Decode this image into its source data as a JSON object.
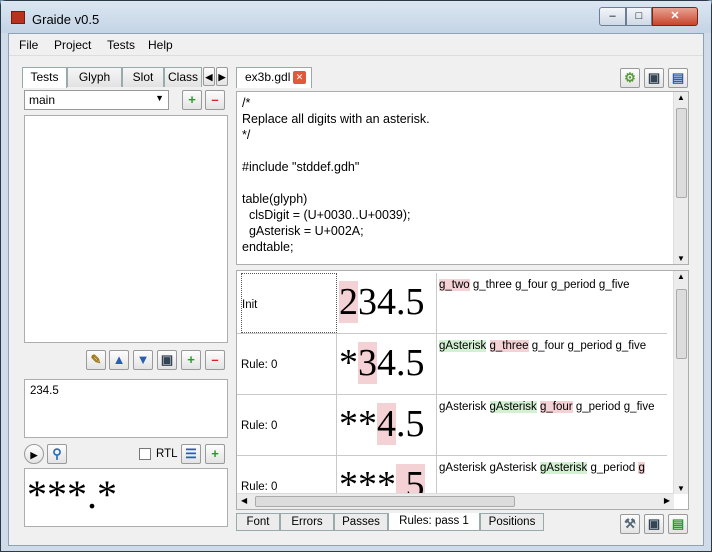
{
  "window": {
    "title": "Graide v0.5"
  },
  "menu": [
    "File",
    "Project",
    "Tests",
    "Help"
  ],
  "left": {
    "tabs": [
      "Tests",
      "Glyph",
      "Slot",
      "Class"
    ],
    "test_group": "main",
    "test_text": "234.5",
    "rtl_label": "RTL",
    "rendered_output": "***.*"
  },
  "editor": {
    "tab": "ex3b.gdl",
    "lines": [
      "/*",
      "Replace all digits with an asterisk.",
      "*/",
      "",
      "#include \"stddef.gdh\"",
      "",
      "table(glyph)",
      "  clsDigit = (U+0030..U+0039);",
      "  gAsterisk = U+002A;",
      "endtable;"
    ]
  },
  "rules": [
    {
      "label": "Init",
      "glyph_prefix": "",
      "glyph_hl": "2",
      "glyph_rest": "34.5",
      "names": [
        {
          "t": "g_two",
          "h": "red"
        },
        {
          "t": "g_three",
          "h": ""
        },
        {
          "t": "g_four",
          "h": ""
        },
        {
          "t": "g_period",
          "h": ""
        },
        {
          "t": "g_five",
          "h": ""
        }
      ]
    },
    {
      "label": "Rule: 0",
      "glyph_prefix": "*",
      "glyph_hl": "3",
      "glyph_rest": "4.5",
      "names": [
        {
          "t": "gAsterisk",
          "h": "green"
        },
        {
          "t": "g_three",
          "h": "red"
        },
        {
          "t": "g_four",
          "h": ""
        },
        {
          "t": "g_period",
          "h": ""
        },
        {
          "t": "g_five",
          "h": ""
        }
      ]
    },
    {
      "label": "Rule: 0",
      "glyph_prefix": "**",
      "glyph_hl": "4",
      "glyph_rest": ".5",
      "names": [
        {
          "t": "gAsterisk",
          "h": ""
        },
        {
          "t": "gAsterisk",
          "h": "green"
        },
        {
          "t": "g_four",
          "h": "red"
        },
        {
          "t": "g_period",
          "h": ""
        },
        {
          "t": "g_five",
          "h": ""
        }
      ]
    },
    {
      "label": "Rule: 0",
      "glyph_prefix": "***",
      "glyph_hl": "",
      "glyph_rest": ".5",
      "names": [
        {
          "t": "gAsterisk",
          "h": ""
        },
        {
          "t": "gAsterisk",
          "h": ""
        },
        {
          "t": "gAsterisk",
          "h": "green"
        },
        {
          "t": "g_period",
          "h": ""
        },
        {
          "t": "g",
          "h": ""
        }
      ]
    }
  ],
  "bottom_tabs": [
    "Font",
    "Errors",
    "Passes",
    "Rules: pass 1",
    "Positions"
  ]
}
